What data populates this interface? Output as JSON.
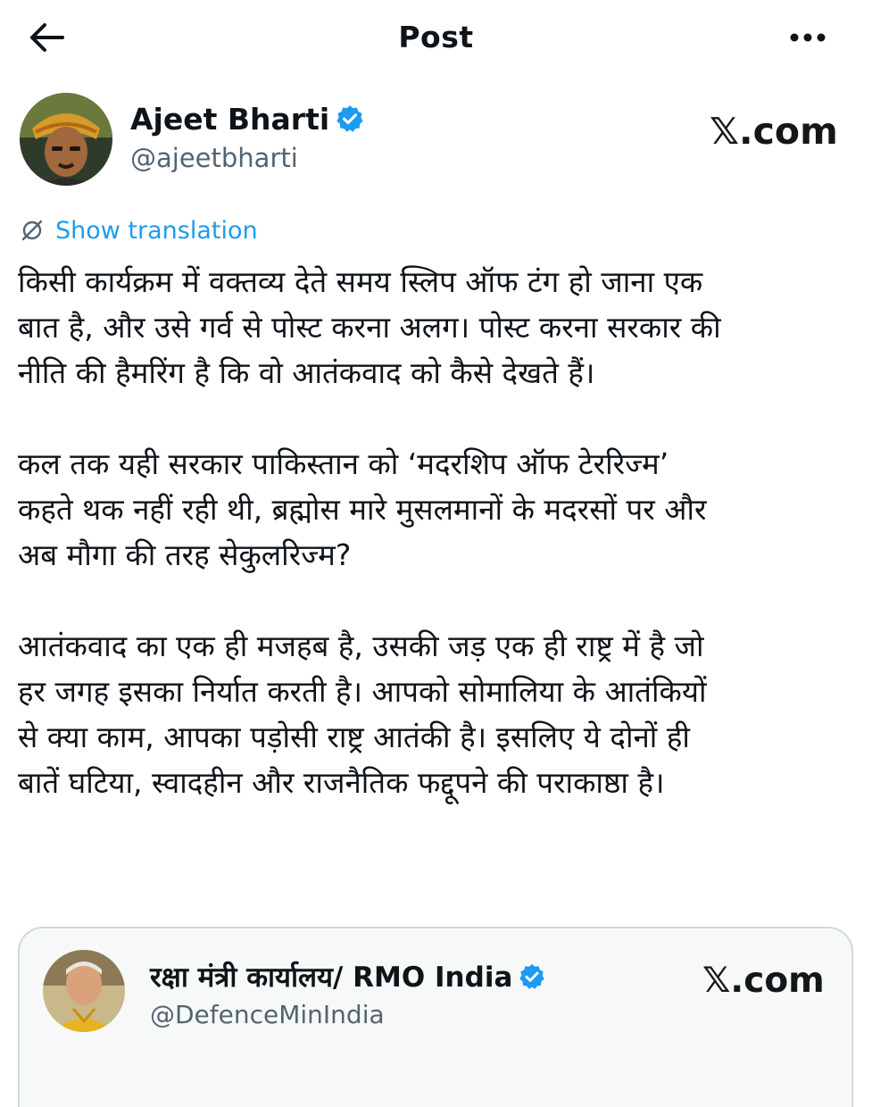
{
  "header": {
    "title": "Post"
  },
  "post": {
    "author_name": "Ajeet Bharti",
    "author_handle": "@ajeetbharti",
    "watermark": "𝕏.com",
    "show_translation": "Show translation",
    "paragraphs": [
      "किसी कार्यक्रम में वक्तव्य देते समय स्लिप ऑफ टंग हो जाना एक\nबात है, और उसे गर्व से पोस्ट करना अलग। पोस्ट करना सरकार की\nनीति की हैमरिंग है कि वो आतंकवाद को कैसे देखते हैं।",
      "कल तक यही सरकार पाकिस्तान को ‘मदरशिप ऑफ टेररिज्म’\nकहते थक नहीं रही थी, ब्रह्मोस मारे मुसलमानों के मदरसों पर और\nअब मौगा की तरह सेकुलरिज्म?",
      "आतंकवाद का एक ही मजहब है, उसकी जड़ एक ही राष्ट्र में है जो\nहर जगह इसका निर्यात करती है। आपको सोमालिया के आतंकियों\nसे क्या काम, आपका पड़ोसी राष्ट्र आतंकी है। इसलिए ये दोनों ही\nबातें घटिया, स्वादहीन और राजनैतिक फद्दूपने की पराकाष्ठा है।"
    ]
  },
  "quoted": {
    "author_name": "रक्षा मंत्री कार्यालय/ RMO India",
    "author_handle": "@DefenceMinIndia",
    "watermark": "𝕏.com"
  },
  "colors": {
    "accent": "#1d9bf0",
    "secondary_text": "#536471",
    "text": "#0f1419"
  }
}
